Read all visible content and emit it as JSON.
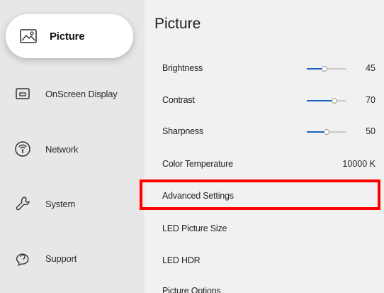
{
  "sidebar": {
    "items": [
      {
        "label": "Picture",
        "icon": "picture-icon"
      },
      {
        "label": "OnScreen Display",
        "icon": "onscreen-display-icon"
      },
      {
        "label": "Network",
        "icon": "network-icon"
      },
      {
        "label": "System",
        "icon": "system-icon"
      },
      {
        "label": "Support",
        "icon": "support-icon"
      }
    ],
    "active": "Picture"
  },
  "main": {
    "title": "Picture",
    "rows": [
      {
        "label": "Brightness",
        "value": "45",
        "slider": 0.45
      },
      {
        "label": "Contrast",
        "value": "70",
        "slider": 0.7
      },
      {
        "label": "Sharpness",
        "value": "50",
        "slider": 0.5
      },
      {
        "label": "Color Temperature",
        "value": "10000 K"
      },
      {
        "label": "Advanced Settings",
        "value": ""
      },
      {
        "label": "LED Picture Size",
        "value": ""
      },
      {
        "label": "LED HDR",
        "value": ""
      },
      {
        "label": "Picture Options",
        "value": ""
      }
    ]
  },
  "colors": {
    "accent": "#1c62c2",
    "highlight_box": "#ff0000",
    "sidebar_bg": "#e7e7e7",
    "main_bg": "#f1f1f1"
  }
}
